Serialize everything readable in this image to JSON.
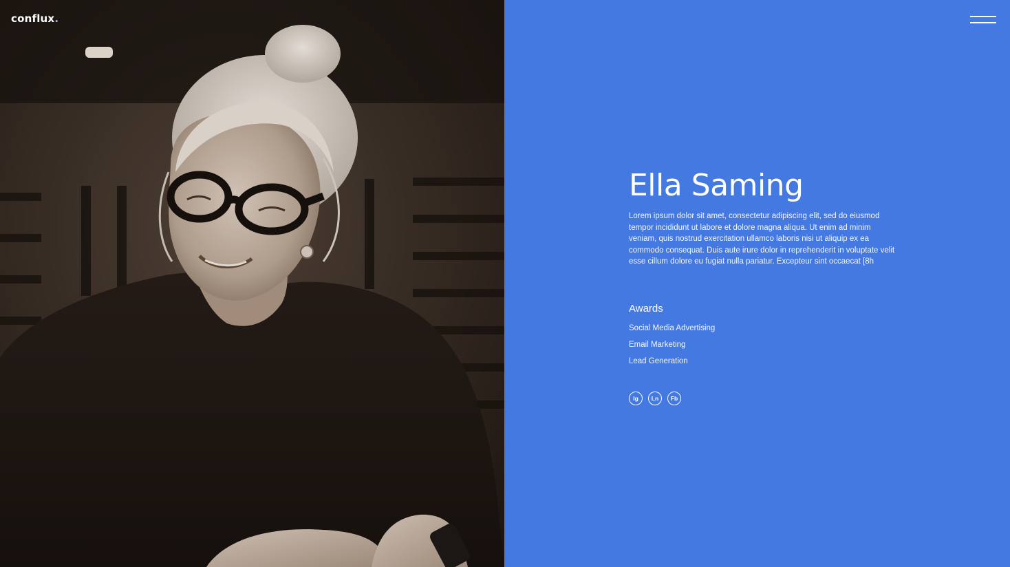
{
  "header": {
    "logo_text": "conflux",
    "logo_dot": ".",
    "menu_icon": "hamburger-menu-icon"
  },
  "profile": {
    "name": "Ella Saming",
    "bio": "Lorem ipsum dolor sit amet, consectetur adipiscing elit, sed do eiusmod tempor incididunt ut labore et dolore magna aliqua. Ut enim ad minim veniam, quis nostrud exercitation ullamco laboris nisi ut aliquip ex ea commodo consequat. Duis aute irure dolor in reprehenderit in voluptate velit esse cillum dolore eu fugiat nulla pariatur. Excepteur sint occaecat [8h",
    "photo_icon": "portrait-photo"
  },
  "awards": {
    "title": "Awards",
    "items": [
      "Social Media Advertising",
      "Email Marketing",
      "Lead Generation"
    ]
  },
  "social": {
    "links": [
      {
        "label": "Ig",
        "icon": "instagram-icon"
      },
      {
        "label": "Ln",
        "icon": "linkedin-icon"
      },
      {
        "label": "Fb",
        "icon": "facebook-icon"
      }
    ]
  },
  "colors": {
    "accent_blue": "#4479e1",
    "photo_dark": "#1a1512",
    "text_white": "#ffffff"
  }
}
